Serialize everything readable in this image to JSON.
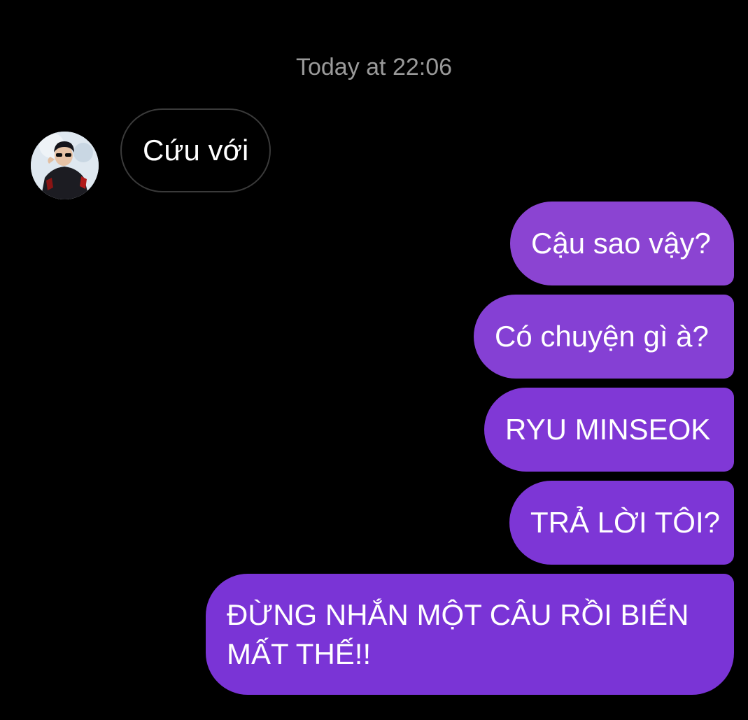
{
  "conversation": {
    "timestamp": "Today at 22:06",
    "received": [
      {
        "text": "Cứu với"
      }
    ],
    "sent": [
      {
        "text": "Cậu sao vậy?"
      },
      {
        "text": "Có chuyện gì à?"
      },
      {
        "text": "RYU MINSEOK"
      },
      {
        "text": "TRẢ LỜI TÔI?"
      },
      {
        "text": "ĐỪNG NHẮN MỘT CÂU RỒI BIẾN MẤT THẾ!!"
      }
    ]
  },
  "colors": {
    "background": "#000000",
    "timestamp": "#9a9a9a",
    "received_border": "#3a3a3a",
    "sent_gradient_top": "#8b44d2",
    "sent_gradient_bottom": "#7a34d6",
    "text": "#ffffff"
  },
  "icons": {
    "avatar": "contact-avatar-photo"
  }
}
